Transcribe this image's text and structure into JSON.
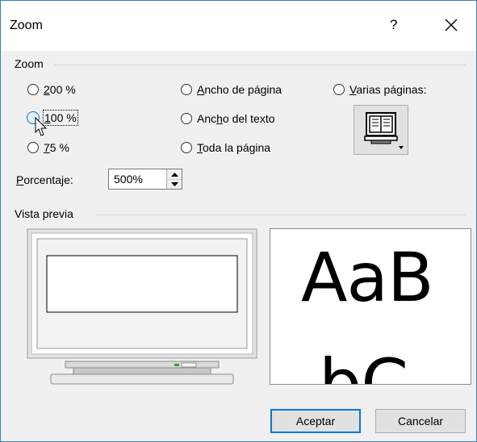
{
  "dialog": {
    "title": "Zoom",
    "help": "?"
  },
  "zoom_group": {
    "label": "Zoom",
    "options": [
      {
        "label_accel": "2",
        "label_rest": "00 %"
      },
      {
        "label_accel": "1",
        "label_rest": "00 %"
      },
      {
        "label_accel": "7",
        "label_rest": "5 %"
      },
      {
        "label_accel": "A",
        "label_rest": "ncho de página"
      },
      {
        "label_pre": "Anc",
        "label_accel": "h",
        "label_rest": "o del texto"
      },
      {
        "label_accel": "T",
        "label_rest": "oda la página"
      },
      {
        "label_accel": "V",
        "label_rest": "arias páginas:"
      }
    ],
    "selected": "100 %"
  },
  "percentage": {
    "label_accel": "P",
    "label_rest": "orcentaje:",
    "value": "500%"
  },
  "preview_group": {
    "label": "Vista previa",
    "sample_text": "AaB",
    "sample_text_line2": "bC"
  },
  "buttons": {
    "ok": "Aceptar",
    "cancel": "Cancelar"
  },
  "icons": [
    "close-icon",
    "monitor-pages-icon",
    "dropdown-arrow-icon",
    "spin-up-icon",
    "spin-down-icon",
    "mouse-cursor-icon"
  ]
}
